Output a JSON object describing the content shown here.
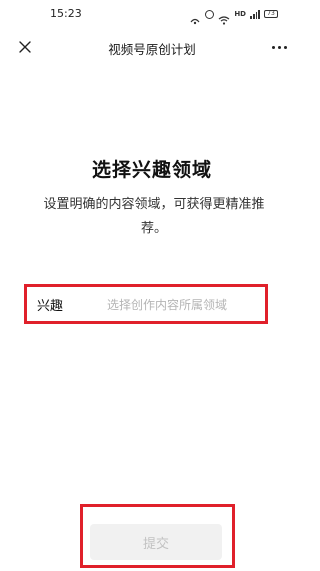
{
  "status_bar": {
    "time": "15:23",
    "hd": "HD",
    "battery": "73"
  },
  "nav": {
    "title": "视频号原创计划",
    "close_icon": "close-icon",
    "more_icon": "more-icon"
  },
  "main": {
    "heading": "选择兴趣领域",
    "description": "设置明确的内容领域，可获得更精准推荐。",
    "interest": {
      "label": "兴趣",
      "placeholder": "选择创作内容所属领域"
    },
    "submit_label": "提交"
  },
  "colors": {
    "highlight": "#e0202a",
    "placeholder": "#b5b5b5",
    "disabled_button_bg": "#f1f1f1",
    "disabled_button_text": "#c2c2c2"
  }
}
